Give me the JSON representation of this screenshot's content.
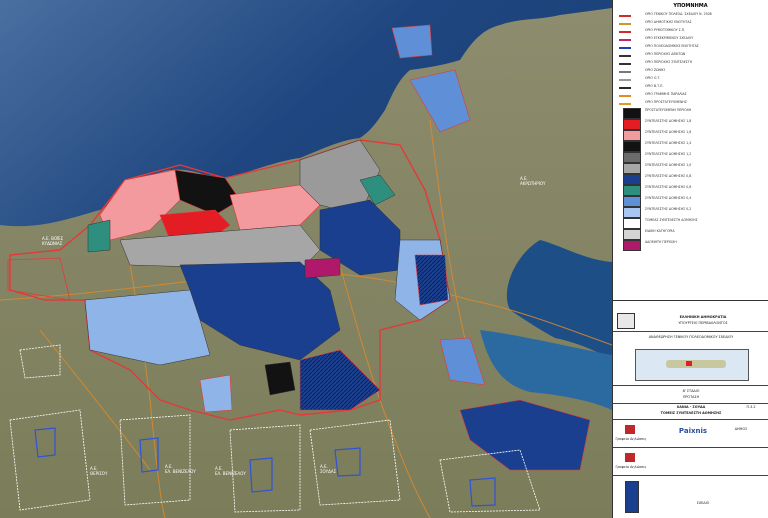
{
  "map": {
    "labels": [
      {
        "text": "Α.Ε. ΒΟΪΕΣ\nΚΥΔΩΝΙΑΣ",
        "key": "a"
      },
      {
        "text": "Α.Ε.\nΑΚΡΩΤΗΡΙΟΥ",
        "key": "b"
      },
      {
        "text": "Α.Ε.\nΘΕΡΙΣΟΥ",
        "key": "c"
      },
      {
        "text": "Α.Ε.\nΕΛ. ΒΕΝΙΖΕΛΟΥ",
        "key": "d"
      },
      {
        "text": "Α.Ε.\nΕΛ. ΒΕΝΙΖΕΛΟΥ",
        "key": "e"
      },
      {
        "text": "Α.Ε.\nΣΟΥΔΑΣ",
        "key": "f"
      }
    ],
    "colors": {
      "sea_deep": "#1a3f74",
      "sea_light": "#2f6a9a",
      "land": "#8c8f6a",
      "pink": "#f29a9e",
      "red": "#e41c24",
      "gray": "#9a9a9a",
      "dark_blue": "#1b3f8f",
      "light_blue": "#8fb4e8",
      "teal": "#2f8f7f",
      "black": "#121212",
      "magenta": "#b0196b",
      "boundary": "#e23a3a"
    }
  },
  "legend": {
    "title": "ΥΠΟΜΝΗΜΑ",
    "items": [
      {
        "label": "ΟΡΙΟ ΓΕΝΙΚΟΥ ΠΟΛΕΟΔ. ΣΧΕΔΙΟΥ Ν. 2508",
        "swatch": "#d22a2a",
        "kind": "line"
      },
      {
        "label": "ΟΡΙΟ ΔΗΜΟΤΙΚΗΣ ΕΝΟΤΗΤΑΣ",
        "swatch": "#c79a2a",
        "kind": "line"
      },
      {
        "label": "ΟΡΙΟ ΡΥΜΟΤΟΜΙΚΟΥ Σ.Π.",
        "swatch": "#d22a2a",
        "kind": "line"
      },
      {
        "label": "ΟΡΙΟ ΕΓΚΕΚΡΙΜΕΝΟΥ ΣΧΕΔΙΟΥ",
        "swatch": "#c0286a",
        "kind": "line"
      },
      {
        "label": "ΟΡΙΟ ΠΟΛΕΟΔΟΜΙΚΗΣ ΕΝΟΤΗΤΑΣ",
        "swatch": "#1f3fbf",
        "kind": "line"
      },
      {
        "label": "ΟΡΙΟ ΠΕΡΙΟΧΗΣ ΔΕΙΚΤΩΝ",
        "swatch": "#333333",
        "kind": "line"
      },
      {
        "label": "ΟΡΙΟ ΠΕΡΙΟΧΗΣ ΣΥΝΤΕΛΕΣΤΗ",
        "swatch": "#333333",
        "kind": "line"
      },
      {
        "label": "ΟΡΙΟ ΖΩΝΗΣ",
        "swatch": "#777777",
        "kind": "line"
      },
      {
        "label": "ΟΡΙΟ Ο.Τ.",
        "swatch": "#999999",
        "kind": "line"
      },
      {
        "label": "ΟΡΙΟ Β.Τ.Π.",
        "swatch": "#2a2a2a",
        "kind": "line"
      },
      {
        "label": "ΟΡΙΟ ΓΡΑΜΜΗΣ ΠΑΡΑΛΙΑΣ",
        "swatch": "#e08a2a",
        "kind": "line"
      },
      {
        "label": "ΟΡΙΟ ΠΡΟΣΤΑΤΕΥΟΜΕΝΗΣ",
        "swatch": "#d8a020",
        "kind": "line"
      },
      {
        "label": "ΠΡΟΣΤΑΤΕΥΟΜΕΝΗ ΠΕΡΙΟΧΗ",
        "swatch": "#111111",
        "kind": "box"
      },
      {
        "label": "ΣΥΝΤΕΛΕΣΤΗΣ ΔΟΜΗΣΗΣ 1,8",
        "swatch": "#e41c24",
        "kind": "box"
      },
      {
        "label": "ΣΥΝΤΕΛΕΣΤΗΣ ΔΟΜΗΣΗΣ 1,6",
        "swatch": "#f29a9e",
        "kind": "box"
      },
      {
        "label": "ΣΥΝΤΕΛΕΣΤΗΣ ΔΟΜΗΣΗΣ 1,4",
        "swatch": "#121212",
        "kind": "box"
      },
      {
        "label": "ΣΥΝΤΕΛΕΣΤΗΣ ΔΟΜΗΣΗΣ 1,2",
        "swatch": "#6b6b6b",
        "kind": "box"
      },
      {
        "label": "ΣΥΝΤΕΛΕΣΤΗΣ ΔΟΜΗΣΗΣ 1,0",
        "swatch": "#a6a6a6",
        "kind": "box"
      },
      {
        "label": "ΣΥΝΤΕΛΕΣΤΗΣ ΔΟΜΗΣΗΣ 0,8",
        "swatch": "#1b3f8f",
        "kind": "box"
      },
      {
        "label": "ΣΥΝΤΕΛΕΣΤΗΣ ΔΟΜΗΣΗΣ 0,6",
        "swatch": "#2f8f7f",
        "kind": "box"
      },
      {
        "label": "ΣΥΝΤΕΛΕΣΤΗΣ ΔΟΜΗΣΗΣ 0,4",
        "swatch": "#5f8fd6",
        "kind": "box"
      },
      {
        "label": "ΣΥΝΤΕΛΕΣΤΗΣ ΔΟΜΗΣΗΣ 0,2",
        "swatch": "#a8c6f0",
        "kind": "box"
      },
      {
        "label": "ΤΟΜΕΑΣ ΣΥΝΤΕΛΕΣΤΗ ΔΟΜΗΣΗΣ",
        "swatch": "#ffffff",
        "kind": "box"
      },
      {
        "label": "ΕΙΔΙΚΗ ΚΑΤΗΓΟΡΙΑ",
        "swatch": "#d4d4d4",
        "kind": "box"
      },
      {
        "label": "ΑΔΟΜΗΤΗ ΠΕΡΙΟΧΗ",
        "swatch": "#b0196b",
        "kind": "box"
      }
    ]
  },
  "title_block": {
    "org": "ΕΛΛΗΝΙΚΗ ΔΗΜΟΚΡΑΤΙΑ",
    "ministry": "ΥΠΟΥΡΓΕΙΟ ΠΕΡΙΒΑΛΛΟΝΤΟΣ",
    "project": "ΑΝΑΘΕΩΡΗΣΗ ΓΕΝΙΚΟΥ ΠΟΛΕΟΔΟΜΙΚΟΥ ΣΧΕΔΙΟΥ",
    "stage": "Β' ΣΤΑΔΙΟ",
    "stage2": "ΠΡΟΤΑΣΗ",
    "sheet_area": "ΧΑΝΙΑ - ΣΟΥΔΑ",
    "sheet_title": "ΤΟΜΕΙΣ ΣΥΝΤΕΛΕΣΤΗ ΔΟΜΗΣΗΣ",
    "sheet_code": "Π.3.2",
    "footer": "ΣΧΕΔΙΟ",
    "logo_text_1": "Γραφείο Δηλώσεις",
    "logo_text_2": "ΔΗΜΟΣ",
    "logo_text_3": "Γραφείο Δηλώσεις",
    "brand": "Paixnis",
    "brand_color": "#2a4fa0"
  }
}
